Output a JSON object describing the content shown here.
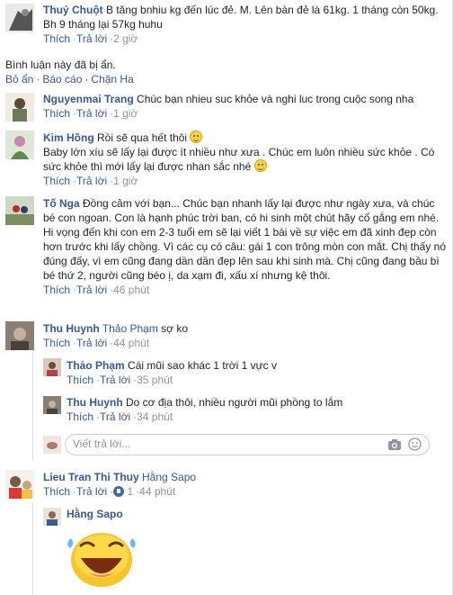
{
  "colors": {
    "link": "#365899",
    "meta": "#90949c",
    "border": "#dddfe2"
  },
  "actions": {
    "like": "Thích",
    "reply": "Trả lời",
    "dot": "·"
  },
  "c1": {
    "name": "Thuỷ Chuột",
    "text": "B tăng bnhiu kg đến lúc đẻ. M. Lên bàn đẻ là 61kg. 1 tháng còn 50kg. Bh 9 tháng lại 57kg huhu",
    "time": "2 giờ"
  },
  "hidden": {
    "text": "Bình luận này đã bị ẩn.",
    "show": "Bỏ ẩn",
    "report": "Báo cáo",
    "block": "Chặn Ha"
  },
  "c2": {
    "name": "Nguyenmai Trang",
    "text": "Chúc bạn nhieu suc khỏe và nghi luc trong cuộc song nha",
    "time": "1 giờ"
  },
  "c3": {
    "name": "Kim Hồng",
    "text1": "Rồi sẽ qua hết thôi",
    "text2": "Baby lớn xíu sẽ lấy lại được ít nhiều như xưa . Chúc em luôn nhiều sức khỏe . Có sức khỏe thì mới lấy lại được nhan sắc nhé",
    "time": "1 giờ"
  },
  "c4": {
    "name": "Tố Nga",
    "text": "Đồng cảm với bạn... Chúc bạn nhanh lấy lại được như ngày xưa, và chúc bé con ngoan. Con là hạnh phúc trời ban, có hi sinh một chút hãy cố gắng em nhé. Hi vọng đến khi con em 2-3 tuổi em sẽ lại viết 1 bài về sự việc em đã xinh đẹp còn hơn trước khi lấy chồng. Vì các cụ có câu: gái 1 con trông mòn con mắt. Chị thấy nó đúng đấy, vì em cũng đang dần dần đẹp lên sau khi sinh mà. Chị cũng đang bầu bì bé thứ 2, người cũng béo ị, da xạm đi, xấu xí nhưng kệ thôi.",
    "time": "46 phút"
  },
  "c5": {
    "name": "Thu Huynh",
    "tag": "Thảo Phạm",
    "text": "sợ ko",
    "time": "44 phút"
  },
  "r1": {
    "name": "Thảo Phạm",
    "text": "Cái mũi sao khác 1 trời 1 vực v",
    "time": "35 phút"
  },
  "r2": {
    "name": "Thu Huynh",
    "text": "Do cơ địa thôi, nhiều người mũi phồng to lắm",
    "time": "34 phút"
  },
  "input": {
    "placeholder": "Viết trả lời..."
  },
  "c6": {
    "name": "Lieu Tran Thi Thuy",
    "tag": "Hằng Sapo",
    "time": "44 phút",
    "likes": "1"
  },
  "r3": {
    "name": "Hằng Sapo"
  }
}
